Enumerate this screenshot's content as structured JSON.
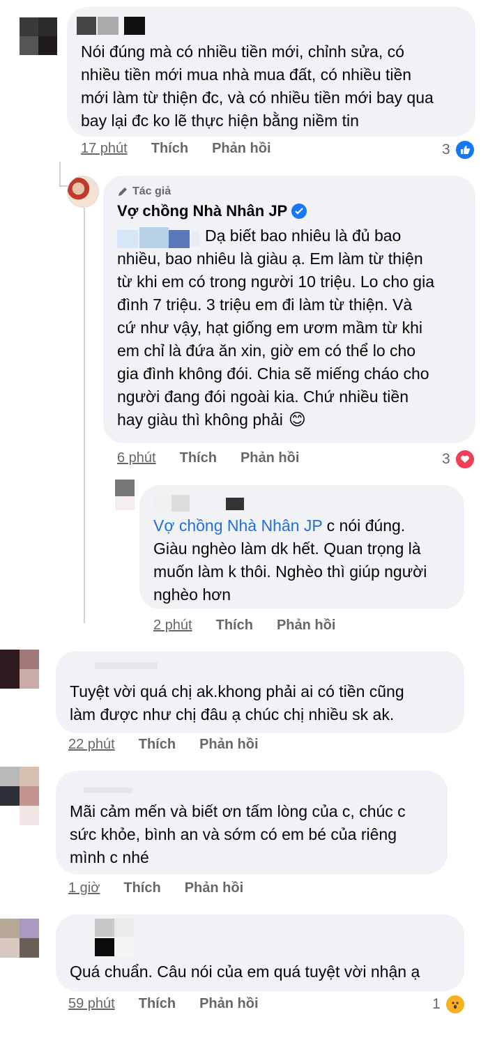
{
  "colors": {
    "bubble": "#f0f2f5",
    "meta": "#65676b",
    "link": "#216fdb",
    "like": "#1877f2",
    "love": "#f33e58",
    "verified": "#1877f2"
  },
  "comments": [
    {
      "text_lines": [
        "Nói đúng mà có nhiều tiền mới, chỉnh sửa, có",
        "nhiều tiền mới mua nhà mua đất, có nhiều tiền",
        "mới làm từ thiện đc, và có nhiều tiền mới bay qua",
        "bay lại đc ko lẽ thực hiện bằng niềm tin"
      ],
      "time": "17 phút",
      "like": "Thích",
      "reply": "Phản hồi",
      "reaction_count": "3",
      "reaction_icon": "like-icon"
    },
    {
      "badge": "Tác giả",
      "author": "Vợ chồng Nhà Nhân JP",
      "text_lines": [
        "Dạ biết bao nhiêu là đủ bao",
        "nhiều,  bao nhiêu là giàu ạ. Em làm từ thiện",
        "từ khi em có trong người 10 triệu. Lo cho gia",
        "đình 7 triệu. 3 triệu em đi làm từ thiện. Và",
        "cứ như vậy, hạt giống em ươm mầm từ khi",
        "em chỉ là đứa ăn xin, giờ em có thể lo cho",
        "gia đình không đói. Chia sẽ miếng cháo cho",
        "người đang đói ngoài kia. Chứ nhiều tiền",
        "hay giàu thì không phải"
      ],
      "emoji": "😊",
      "time": "6 phút",
      "like": "Thích",
      "reply": "Phản hồi",
      "reaction_count": "3",
      "reaction_icon": "love-icon"
    },
    {
      "mention": "Vợ chồng Nhà Nhân JP",
      "text_lines": [
        " c nói đúng.",
        "Giàu nghèo làm dk hết. Quan trọng là",
        "muốn làm k thôi. Nghèo thì giúp người",
        "nghèo hơn"
      ],
      "time": "2 phút",
      "like": "Thích",
      "reply": "Phản hồi"
    },
    {
      "text_lines": [
        "Tuyệt vời quá chị ak.khong phải ai có tiền cũng",
        "làm được như chị đâu ạ chúc chị nhiều sk ak."
      ],
      "time": "22 phút",
      "like": "Thích",
      "reply": "Phản hồi"
    },
    {
      "text_lines": [
        "Mãi cảm mến và biết ơn tấm lòng của c, chúc c",
        "sức khỏe, bình an và sớm có em bé của riêng",
        "mình c nhé"
      ],
      "time": "1 giờ",
      "like": "Thích",
      "reply": "Phản hồi"
    },
    {
      "text_lines": [
        "Quá chuẩn. Câu nói của em quá tuyệt vời  nhận ạ"
      ],
      "time": "59 phút",
      "like": "Thích",
      "reply": "Phản hồi",
      "reaction_count": "1",
      "reaction_icon": "wow-icon"
    }
  ]
}
